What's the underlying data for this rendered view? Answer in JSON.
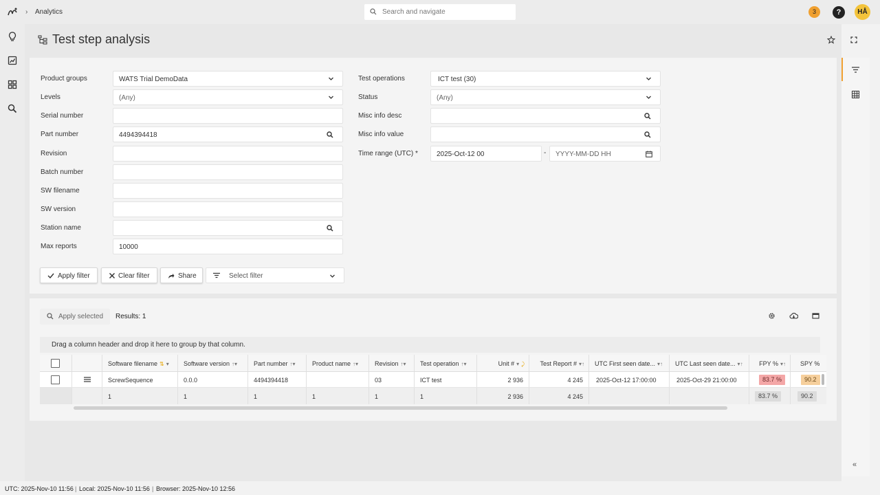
{
  "topbar": {
    "breadcrumb": "Analytics",
    "search_placeholder": "Search and navigate",
    "notifications": "3",
    "help": "?",
    "user_initials": "HÅ"
  },
  "page": {
    "title": "Test step analysis"
  },
  "filters": {
    "product_groups": {
      "label": "Product groups",
      "value": "WATS Trial DemoData"
    },
    "levels": {
      "label": "Levels",
      "value": "(Any)"
    },
    "serial_number": {
      "label": "Serial number",
      "value": ""
    },
    "part_number": {
      "label": "Part number",
      "value": "4494394418"
    },
    "revision": {
      "label": "Revision",
      "value": ""
    },
    "batch_number": {
      "label": "Batch number",
      "value": ""
    },
    "sw_filename": {
      "label": "SW filename",
      "value": ""
    },
    "sw_version": {
      "label": "SW version",
      "value": ""
    },
    "station_name": {
      "label": "Station name",
      "value": ""
    },
    "max_reports": {
      "label": "Max reports",
      "value": "10000"
    },
    "test_operations": {
      "label": "Test operations",
      "value": "ICT test (30)"
    },
    "status": {
      "label": "Status",
      "value": "(Any)"
    },
    "misc_info_desc": {
      "label": "Misc info desc",
      "value": ""
    },
    "misc_info_value": {
      "label": "Misc info value",
      "value": ""
    },
    "time_range": {
      "label": "Time range (UTC) *",
      "from": "2025-Oct-12 00",
      "to_placeholder": "YYYY-MM-DD HH"
    }
  },
  "actions": {
    "apply_filter": "Apply filter",
    "clear_filter": "Clear filter",
    "share": "Share",
    "select_filter": "Select filter"
  },
  "results": {
    "apply_selected": "Apply selected",
    "count_text": "Results: 1",
    "group_hint": "Drag a column header and drop it here to group by that column."
  },
  "grid": {
    "columns": [
      "Software filename",
      "Software version",
      "Part number",
      "Product name",
      "Revision",
      "Test operation",
      "Unit #",
      "Test Report #",
      "UTC First seen date...",
      "UTC Last seen date...",
      "FPY %",
      "SPY %"
    ],
    "row": {
      "software_filename": "ScrewSequence",
      "software_version": "0.0.0",
      "part_number": "4494394418",
      "product_name": "",
      "revision": "03",
      "test_operation": "ICT test",
      "unit_count": "2 936",
      "test_report_count": "4 245",
      "first_seen": "2025-Oct-12 17:00:00",
      "last_seen": "2025-Oct-29 21:00:00",
      "fpy": "83.7 %",
      "spy": "90.2"
    },
    "totals": {
      "software_filename": "1",
      "software_version": "1",
      "part_number": "1",
      "product_name": "1",
      "revision": "1",
      "test_operation": "1",
      "unit_count": "2 936",
      "test_report_count": "4 245",
      "fpy": "83.7 %",
      "spy": "90.2"
    }
  },
  "colors": {
    "accent": "#f0a030",
    "fpy_bad": "#f4a7a7",
    "spy_warn": "#f6cf9c"
  },
  "footer": {
    "utc": "UTC: 2025-Nov-10 11:56",
    "local": "Local: 2025-Nov-10 11:56",
    "browser": "Browser: 2025-Nov-10 12:56"
  }
}
